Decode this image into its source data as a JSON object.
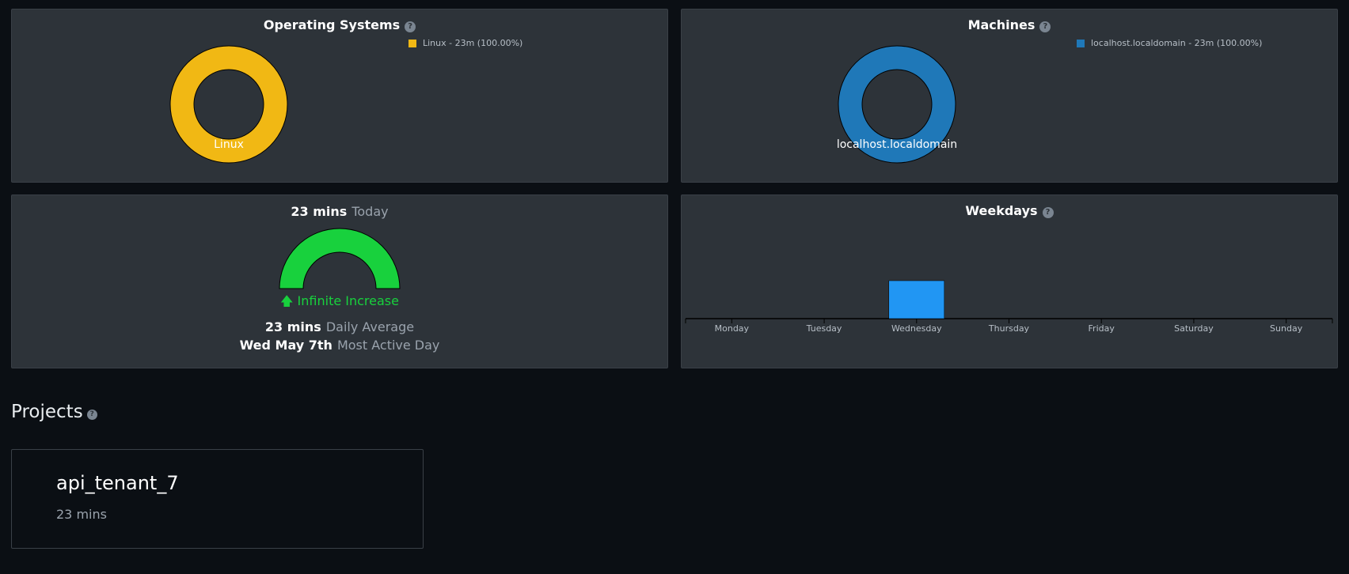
{
  "os_panel": {
    "title": "Operating Systems",
    "legend": "Linux - 23m (100.00%)",
    "slice_label": "Linux",
    "color": "#f1b814"
  },
  "machines_panel": {
    "title": "Machines",
    "legend": "localhost.localdomain - 23m (100.00%)",
    "slice_label": "localhost.localdomain",
    "color": "#1f78b8"
  },
  "today_panel": {
    "value": "23 mins",
    "label": "Today",
    "gauge_color": "#18d13d",
    "increase_text": "Infinite Increase",
    "daily_avg_value": "23 mins",
    "daily_avg_label": "Daily Average",
    "most_active_value": "Wed May 7th",
    "most_active_label": "Most Active Day"
  },
  "weekdays_panel": {
    "title": "Weekdays"
  },
  "chart_data": {
    "type": "bar",
    "categories": [
      "Monday",
      "Tuesday",
      "Wednesday",
      "Thursday",
      "Friday",
      "Saturday",
      "Sunday"
    ],
    "values": [
      0,
      0,
      23,
      0,
      0,
      0,
      0
    ],
    "ylabel": "",
    "xlabel": "",
    "ylim": [
      0,
      23
    ],
    "bar_color": "#2196f3"
  },
  "projects": {
    "title": "Projects",
    "items": [
      {
        "name": "api_tenant_7",
        "time": "23 mins"
      }
    ]
  }
}
